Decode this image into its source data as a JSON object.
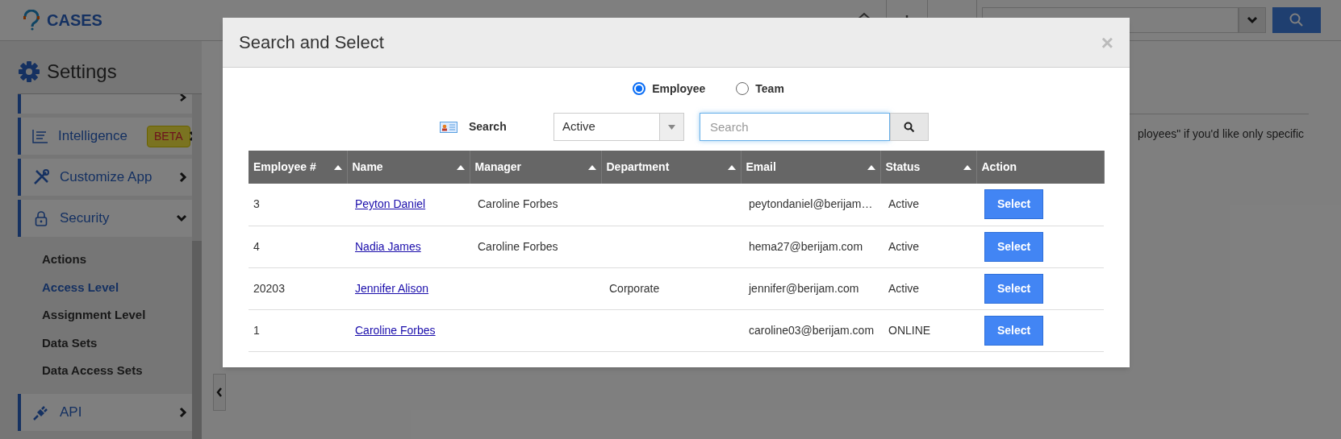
{
  "app": {
    "title": "CASES"
  },
  "settings": {
    "title": "Settings",
    "items": [
      {
        "label": "Intelligence",
        "badge": "BETA",
        "expanded": false
      },
      {
        "label": "Customize App",
        "expanded": false
      },
      {
        "label": "Security",
        "expanded": true,
        "children": [
          {
            "label": "Actions",
            "selected": false
          },
          {
            "label": "Access Level",
            "selected": true
          },
          {
            "label": "Assignment Level",
            "selected": false
          },
          {
            "label": "Data Sets",
            "selected": false
          },
          {
            "label": "Data Access Sets",
            "selected": false
          }
        ]
      },
      {
        "label": "API",
        "expanded": false
      }
    ]
  },
  "background_text": "ployees\" if you'd like only specific",
  "dialog": {
    "title": "Search and Select",
    "close": "×",
    "types": [
      {
        "label": "Employee",
        "selected": true
      },
      {
        "label": "Team",
        "selected": false
      }
    ],
    "search_label": "Search",
    "filter": "Active",
    "search": {
      "placeholder": "Search"
    },
    "table": {
      "columns": [
        {
          "label": "Employee #",
          "sortable": true
        },
        {
          "label": "Name",
          "sortable": true
        },
        {
          "label": "Manager",
          "sortable": true
        },
        {
          "label": "Department",
          "sortable": true
        },
        {
          "label": "Email",
          "sortable": true
        },
        {
          "label": "Status",
          "sortable": true
        },
        {
          "label": "Action",
          "sortable": false
        }
      ],
      "rows": [
        {
          "employee_no": "3",
          "name": "Peyton Daniel",
          "manager": "Caroline Forbes",
          "email": "peytondaniel@berijam…",
          "status": "Active",
          "action": "Select"
        },
        {
          "employee_no": "4",
          "name": "Nadia James",
          "manager": "Caroline Forbes",
          "email": "hema27@berijam.com",
          "status": "Active",
          "action": "Select"
        },
        {
          "employee_no": "20203",
          "name": "Jennifer Alison",
          "department": "Corporate",
          "email": "jennifer@berijam.com",
          "status": "Active",
          "action": "Select"
        },
        {
          "employee_no": "1",
          "name": "Caroline Forbes",
          "email": "caroline03@berijam.com",
          "status": "ONLINE",
          "action": "Select"
        }
      ]
    }
  }
}
